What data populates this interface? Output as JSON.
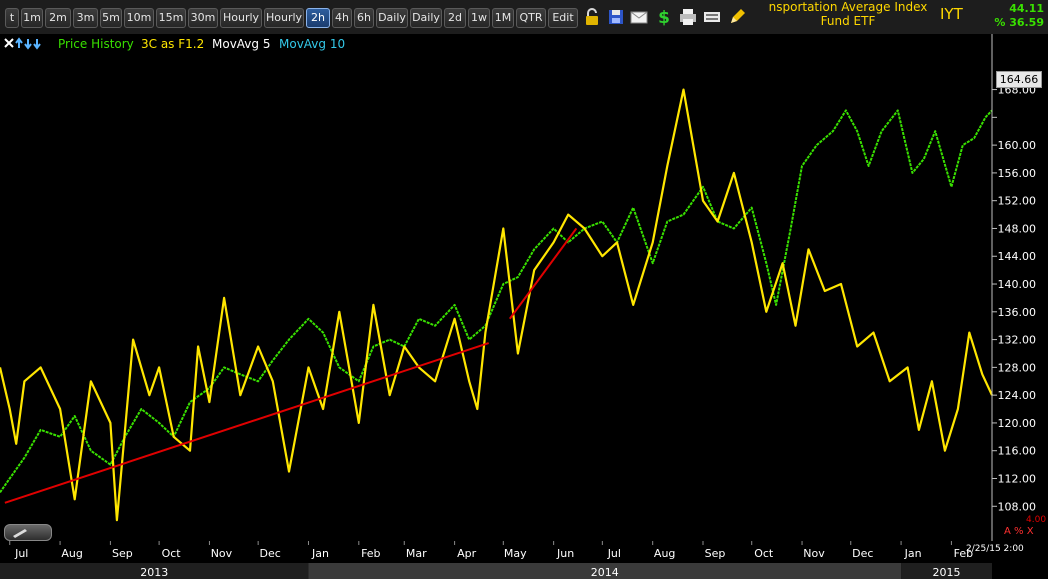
{
  "toolbar": {
    "buttons": [
      "t",
      "1m",
      "2m",
      "3m",
      "5m",
      "10m",
      "15m",
      "30m",
      "Hourly",
      "Hourly",
      "2h",
      "4h",
      "6h",
      "Daily",
      "Daily",
      "2d",
      "1w",
      "1M",
      "QTR",
      "Edit"
    ],
    "active": "2h",
    "icons": [
      "lock-icon",
      "save-icon",
      "mail-icon",
      "dollar-icon",
      "print-icon",
      "keyboard-icon",
      "pencil-icon"
    ]
  },
  "header": {
    "title_line1": "nsportation Average Index",
    "title_line2": "Fund ETF",
    "symbol": "IYT",
    "top_right_1": "44.11",
    "top_right_2": "% 36.59"
  },
  "legend": {
    "items": [
      {
        "label": "Price History",
        "color": "#39e000"
      },
      {
        "label": "3C as F1.2",
        "color": "#ffe600"
      },
      {
        "label": "MovAvg 5",
        "color": "#ffffff"
      },
      {
        "label": "MovAvg 10",
        "color": "#33c8e8"
      }
    ]
  },
  "right_axis": {
    "current_price": "164.66",
    "small_label": "4.00",
    "icons_text": "A % X",
    "date_stamp": "2/25/15 2:00"
  },
  "chart_data": {
    "type": "line",
    "y_ticks": [
      108,
      112,
      116,
      120,
      124,
      128,
      132,
      136,
      140,
      144,
      148,
      152,
      156,
      160,
      164,
      168
    ],
    "y_tick_labels": [
      "108.00",
      "112.00",
      "116.00",
      "120.00",
      "124.00",
      "128.00",
      "132.00",
      "136.00",
      "140.00",
      "144.00",
      "148.00",
      "152.00",
      "156.00",
      "160.00",
      "",
      "168.00"
    ],
    "ylim": [
      103,
      176
    ],
    "x_months": [
      "Jul",
      "Aug",
      "Sep",
      "Oct",
      "Nov",
      "Dec",
      "Jan",
      "Feb",
      "Mar",
      "Apr",
      "May",
      "Jun",
      "Jul",
      "Aug",
      "Sep",
      "Oct",
      "Nov",
      "Dec",
      "Jan",
      "Feb"
    ],
    "x_years": [
      "2013",
      "2014",
      "2015"
    ],
    "xlim": [
      "2013-06-25",
      "2015-02-26"
    ],
    "series": [
      {
        "name": "Price History",
        "color": "#39e000",
        "points": [
          [
            "2013-06-25",
            110
          ],
          [
            "2013-07-01",
            112
          ],
          [
            "2013-07-10",
            115
          ],
          [
            "2013-07-20",
            119
          ],
          [
            "2013-08-01",
            118
          ],
          [
            "2013-08-10",
            121
          ],
          [
            "2013-08-20",
            116
          ],
          [
            "2013-09-01",
            114
          ],
          [
            "2013-09-10",
            118
          ],
          [
            "2013-09-20",
            122
          ],
          [
            "2013-10-01",
            120
          ],
          [
            "2013-10-10",
            118
          ],
          [
            "2013-10-20",
            123
          ],
          [
            "2013-11-01",
            125
          ],
          [
            "2013-11-10",
            128
          ],
          [
            "2013-11-20",
            127
          ],
          [
            "2013-12-01",
            126
          ],
          [
            "2013-12-10",
            129
          ],
          [
            "2013-12-20",
            132
          ],
          [
            "2014-01-01",
            135
          ],
          [
            "2014-01-10",
            133
          ],
          [
            "2014-01-20",
            128
          ],
          [
            "2014-02-01",
            126
          ],
          [
            "2014-02-10",
            131
          ],
          [
            "2014-02-20",
            132
          ],
          [
            "2014-03-01",
            131
          ],
          [
            "2014-03-10",
            135
          ],
          [
            "2014-03-20",
            134
          ],
          [
            "2014-04-01",
            137
          ],
          [
            "2014-04-10",
            132
          ],
          [
            "2014-04-20",
            134
          ],
          [
            "2014-05-01",
            140
          ],
          [
            "2014-05-10",
            141
          ],
          [
            "2014-05-20",
            145
          ],
          [
            "2014-06-01",
            148
          ],
          [
            "2014-06-10",
            146
          ],
          [
            "2014-06-20",
            148
          ],
          [
            "2014-07-01",
            149
          ],
          [
            "2014-07-10",
            146
          ],
          [
            "2014-07-20",
            151
          ],
          [
            "2014-08-01",
            143
          ],
          [
            "2014-08-10",
            149
          ],
          [
            "2014-08-20",
            150
          ],
          [
            "2014-09-01",
            154
          ],
          [
            "2014-09-10",
            149
          ],
          [
            "2014-09-20",
            148
          ],
          [
            "2014-10-01",
            151
          ],
          [
            "2014-10-10",
            143
          ],
          [
            "2014-10-16",
            137
          ],
          [
            "2014-10-25",
            148
          ],
          [
            "2014-11-01",
            157
          ],
          [
            "2014-11-10",
            160
          ],
          [
            "2014-11-20",
            162
          ],
          [
            "2014-11-28",
            165
          ],
          [
            "2014-12-05",
            162
          ],
          [
            "2014-12-12",
            157
          ],
          [
            "2014-12-20",
            162
          ],
          [
            "2014-12-30",
            165
          ],
          [
            "2015-01-08",
            156
          ],
          [
            "2015-01-15",
            158
          ],
          [
            "2015-01-22",
            162
          ],
          [
            "2015-02-01",
            154
          ],
          [
            "2015-02-08",
            160
          ],
          [
            "2015-02-15",
            161
          ],
          [
            "2015-02-22",
            164
          ],
          [
            "2015-02-26",
            165
          ]
        ]
      },
      {
        "name": "3C as F1.2",
        "color": "#ffe600",
        "points": [
          [
            "2013-06-25",
            128
          ],
          [
            "2013-07-01",
            122
          ],
          [
            "2013-07-05",
            117
          ],
          [
            "2013-07-10",
            126
          ],
          [
            "2013-07-20",
            128
          ],
          [
            "2013-08-01",
            122
          ],
          [
            "2013-08-10",
            109
          ],
          [
            "2013-08-20",
            126
          ],
          [
            "2013-09-01",
            120
          ],
          [
            "2013-09-05",
            106
          ],
          [
            "2013-09-15",
            132
          ],
          [
            "2013-09-25",
            124
          ],
          [
            "2013-10-01",
            128
          ],
          [
            "2013-10-10",
            118
          ],
          [
            "2013-10-20",
            116
          ],
          [
            "2013-10-25",
            131
          ],
          [
            "2013-11-01",
            123
          ],
          [
            "2013-11-10",
            138
          ],
          [
            "2013-11-20",
            124
          ],
          [
            "2013-12-01",
            131
          ],
          [
            "2013-12-10",
            126
          ],
          [
            "2013-12-20",
            113
          ],
          [
            "2014-01-01",
            128
          ],
          [
            "2014-01-10",
            122
          ],
          [
            "2014-01-20",
            136
          ],
          [
            "2014-02-01",
            120
          ],
          [
            "2014-02-10",
            137
          ],
          [
            "2014-02-20",
            124
          ],
          [
            "2014-03-01",
            131
          ],
          [
            "2014-03-10",
            128
          ],
          [
            "2014-03-20",
            126
          ],
          [
            "2014-04-01",
            135
          ],
          [
            "2014-04-10",
            126
          ],
          [
            "2014-04-15",
            122
          ],
          [
            "2014-04-20",
            133
          ],
          [
            "2014-05-01",
            148
          ],
          [
            "2014-05-10",
            130
          ],
          [
            "2014-05-20",
            142
          ],
          [
            "2014-06-01",
            146
          ],
          [
            "2014-06-10",
            150
          ],
          [
            "2014-06-20",
            148
          ],
          [
            "2014-07-01",
            144
          ],
          [
            "2014-07-10",
            146
          ],
          [
            "2014-07-20",
            137
          ],
          [
            "2014-08-01",
            146
          ],
          [
            "2014-08-10",
            157
          ],
          [
            "2014-08-20",
            168
          ],
          [
            "2014-09-01",
            152
          ],
          [
            "2014-09-10",
            149
          ],
          [
            "2014-09-20",
            156
          ],
          [
            "2014-10-01",
            146
          ],
          [
            "2014-10-10",
            136
          ],
          [
            "2014-10-20",
            143
          ],
          [
            "2014-10-28",
            134
          ],
          [
            "2014-11-05",
            145
          ],
          [
            "2014-11-15",
            139
          ],
          [
            "2014-11-25",
            140
          ],
          [
            "2014-12-05",
            131
          ],
          [
            "2014-12-15",
            133
          ],
          [
            "2014-12-25",
            126
          ],
          [
            "2015-01-05",
            128
          ],
          [
            "2015-01-12",
            119
          ],
          [
            "2015-01-20",
            126
          ],
          [
            "2015-01-28",
            116
          ],
          [
            "2015-02-05",
            122
          ],
          [
            "2015-02-12",
            133
          ],
          [
            "2015-02-20",
            127
          ],
          [
            "2015-02-26",
            124
          ]
        ]
      }
    ],
    "trendlines": [
      {
        "color": "#e00000",
        "from": [
          "2013-06-28",
          108.5
        ],
        "to": [
          "2014-04-22",
          131.5
        ]
      },
      {
        "color": "#e00000",
        "from": [
          "2014-05-05",
          135
        ],
        "to": [
          "2014-06-15",
          148
        ]
      }
    ]
  }
}
